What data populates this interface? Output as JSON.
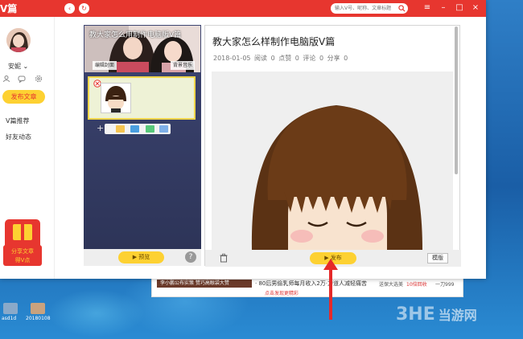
{
  "app": {
    "logo": "V篇",
    "search": {
      "placeholder": "输入V号、昵称、文章标题"
    },
    "window_controls": {
      "menu": "≡",
      "minimize": "–",
      "maximize": "□",
      "close": "×"
    },
    "colors": {
      "brand_red": "#e7362f",
      "accent_yellow": "#fdd132"
    }
  },
  "sidebar": {
    "username": "安妮",
    "username_caret": "⌄",
    "publish_article": "发布文章",
    "links": [
      "V篇推荐",
      "好友动态"
    ],
    "promo": {
      "line1": "分享文章",
      "line2": "得V点"
    }
  },
  "editor": {
    "cover_title": "教大家怎么用制作电脑版V篇",
    "edit_cover": "编辑封面",
    "background_music": "背景音乐",
    "preview_button": "预览",
    "help": "?"
  },
  "preview": {
    "title": "教大家怎么样制作电脑版V篇",
    "meta": {
      "date": "2018-01-05",
      "reads": "阅读 0",
      "likes": "点赞 0",
      "comments": "评论 0",
      "shares": "分享 0"
    },
    "publish_button": "发布",
    "template_button": "模版"
  },
  "ad": {
    "left": "李小鹏公布实策 赞巧高眼袋大赞",
    "middle": "· 80后男偷乳师每月收入2万·力道人减轻痛苦",
    "sub": "点击发现更精彩",
    "r1": "送保大选美",
    "r2": "10倍回收",
    "r3": "一刀999"
  },
  "desktop": {
    "brand_mark": "3HE",
    "brand_cn": "当游网",
    "icon_labels": [
      "asd1d",
      "20180108"
    ]
  }
}
